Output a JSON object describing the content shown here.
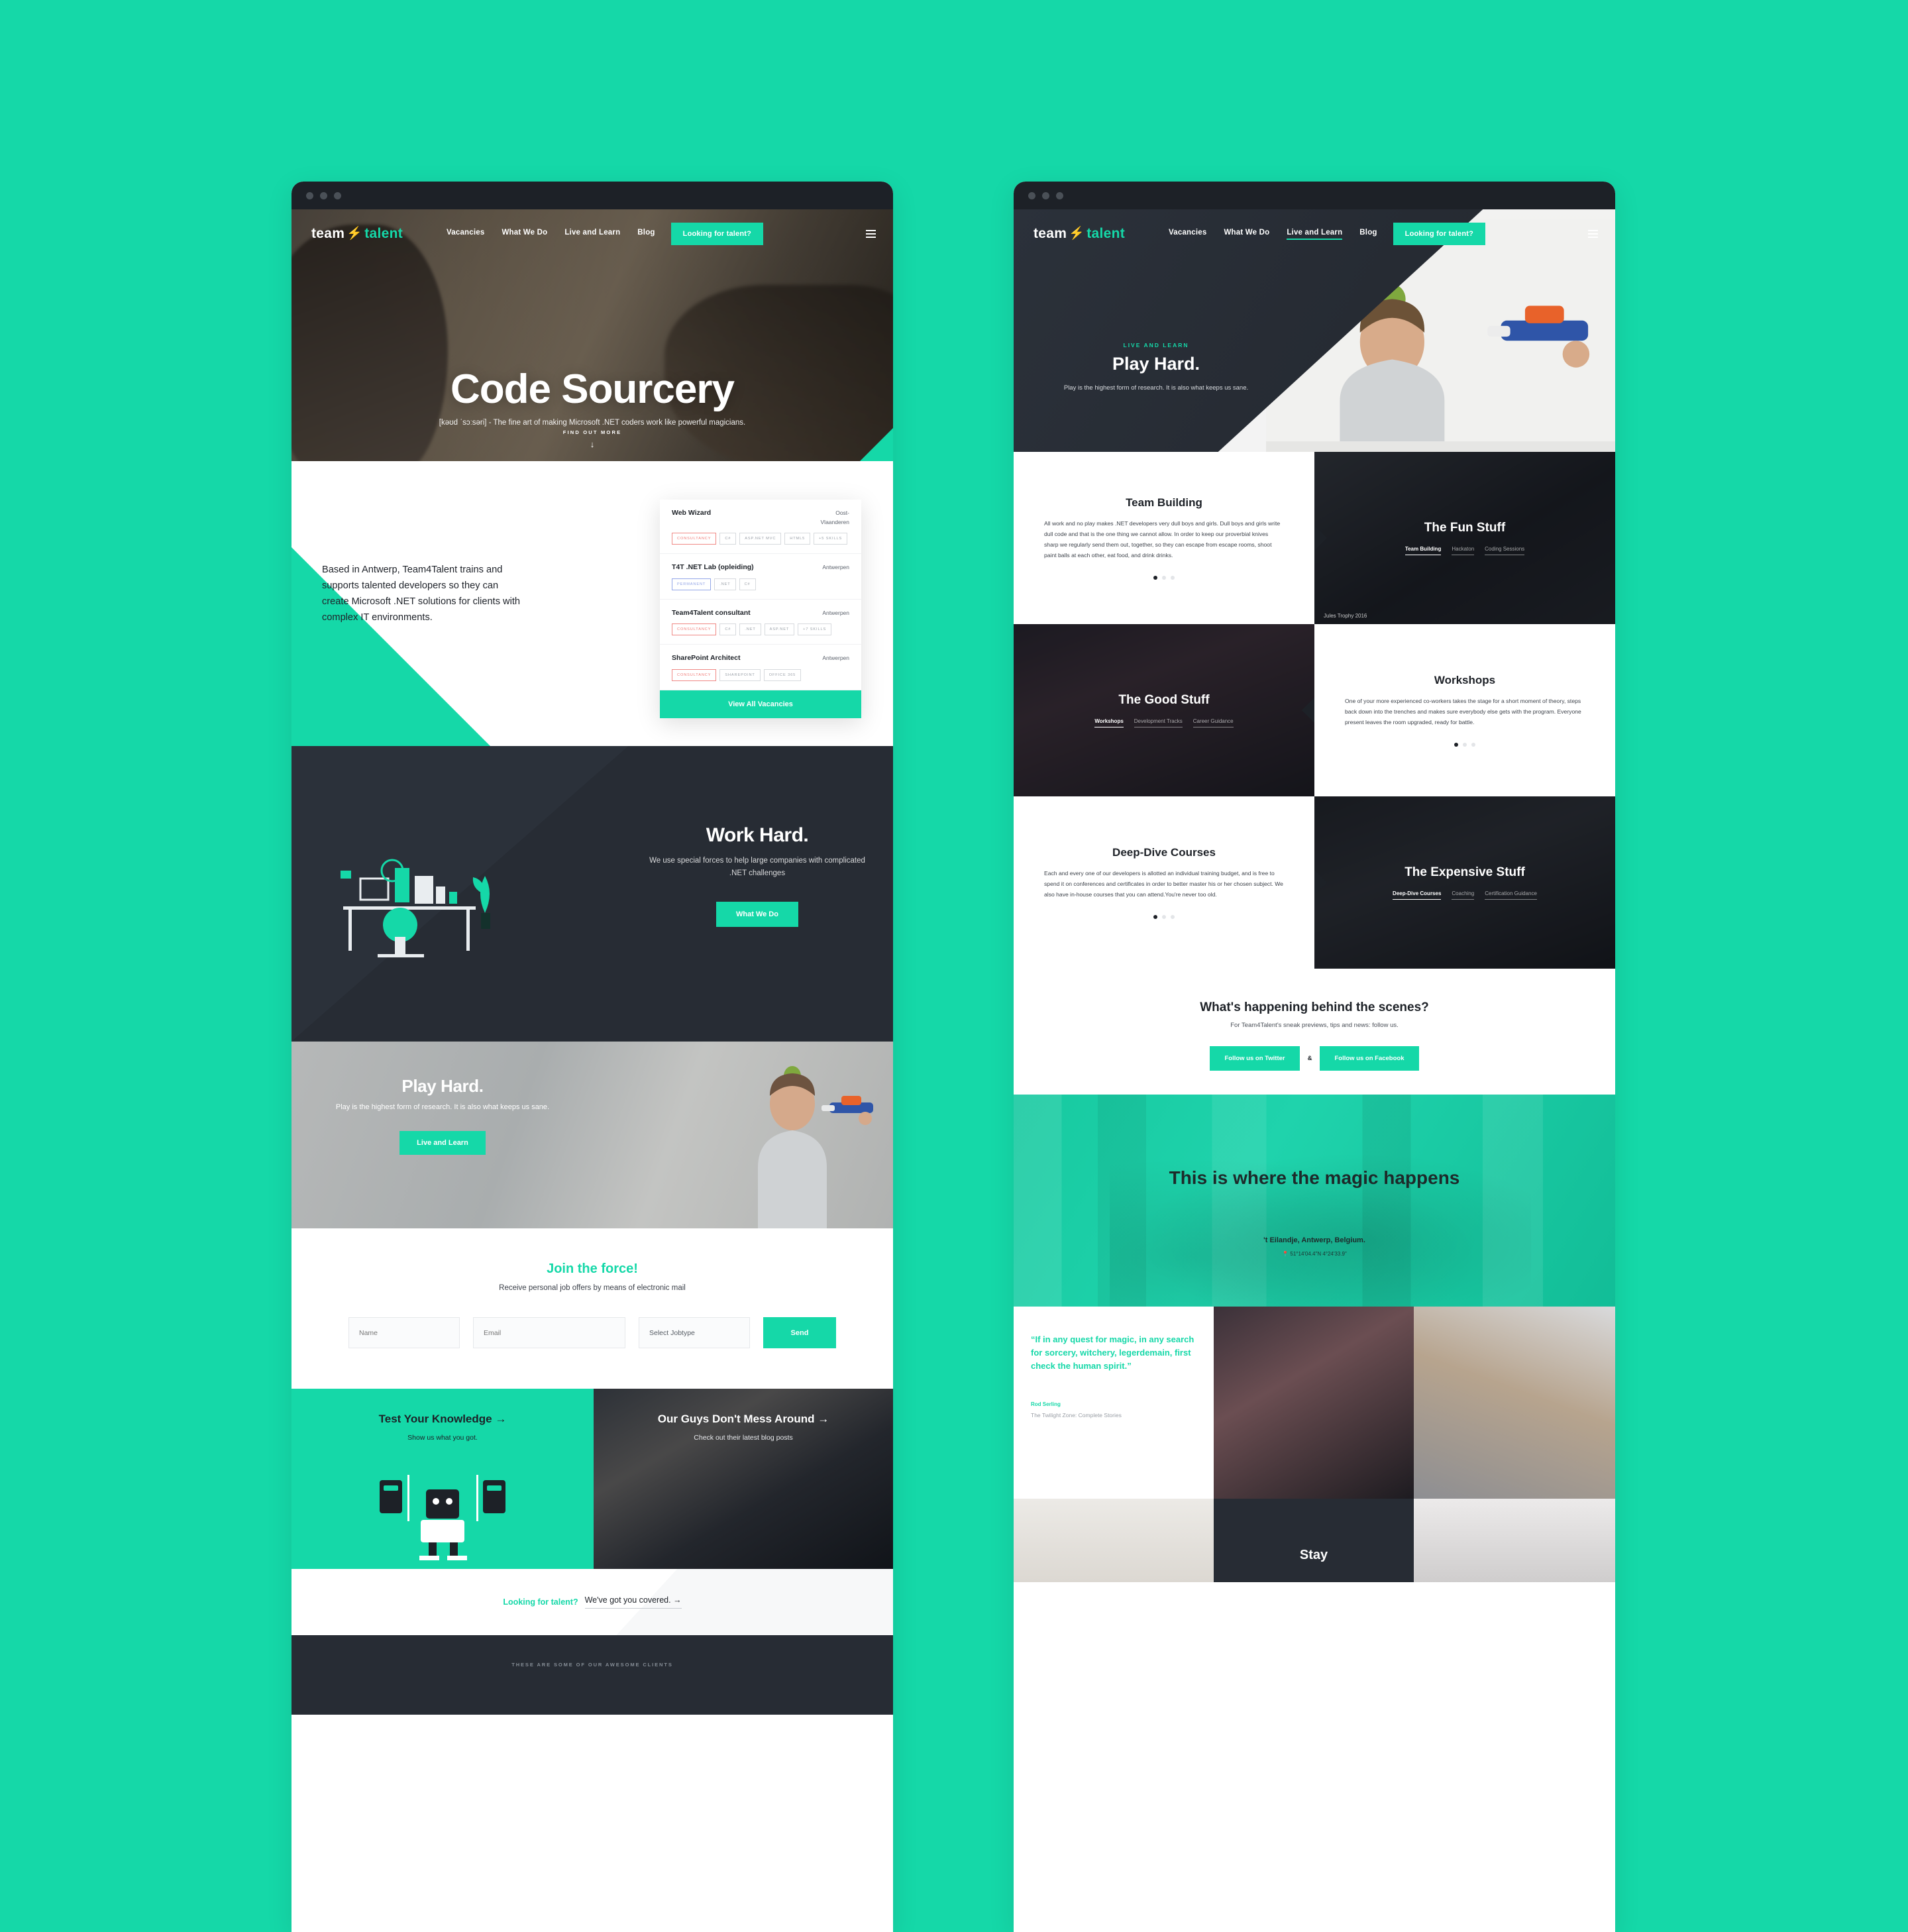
{
  "brand": {
    "name_1": "team",
    "bolt": "⚡",
    "name_2": "talent",
    "accent": "#15D8A8",
    "dark": "#272c34"
  },
  "nav": {
    "links": [
      {
        "label": "Vacancies",
        "active": false
      },
      {
        "label": "What We Do",
        "active": false
      },
      {
        "label": "Live and Learn",
        "active": false
      },
      {
        "label": "Blog",
        "active": false
      }
    ],
    "links_right": [
      {
        "label": "Vacancies",
        "active": false
      },
      {
        "label": "What We Do",
        "active": false
      },
      {
        "label": "Live and Learn",
        "active": true
      },
      {
        "label": "Blog",
        "active": false
      }
    ],
    "cta": "Looking for talent?"
  },
  "left": {
    "hero": {
      "title": "Code Sourcery",
      "subtitle": "[kəʊd ˈsɔːsəri] - The fine art of making Microsoft .NET coders work like powerful magicians.",
      "scroll_label": "FIND OUT MORE",
      "scroll_arrow": "↓"
    },
    "intro": {
      "text": "Based in Antwerp, Team4Talent trains and supports talented developers so they can create Microsoft .NET solutions for clients with complex IT environments."
    },
    "vacancies": {
      "items": [
        {
          "title": "Web Wizard",
          "location": "Oost-Vlaanderen",
          "tags": [
            {
              "label": "CONSULTANCY",
              "style": "red"
            },
            {
              "label": "C#",
              "style": "grey"
            },
            {
              "label": "ASP.NET MVC",
              "style": "grey"
            },
            {
              "label": "HTML5",
              "style": "grey"
            },
            {
              "label": "+5 SKILLS",
              "style": "grey"
            }
          ]
        },
        {
          "title": "T4T .NET Lab (opleiding)",
          "location": "Antwerpen",
          "tags": [
            {
              "label": "PERMANENT",
              "style": "blue"
            },
            {
              "label": ".NET",
              "style": "grey"
            },
            {
              "label": "C#",
              "style": "grey"
            }
          ]
        },
        {
          "title": "Team4Talent consultant",
          "location": "Antwerpen",
          "tags": [
            {
              "label": "CONSULTANCY",
              "style": "red"
            },
            {
              "label": "C#",
              "style": "grey"
            },
            {
              "label": ".NET",
              "style": "grey"
            },
            {
              "label": "ASP.NET",
              "style": "grey"
            },
            {
              "label": "+7 SKILLS",
              "style": "grey"
            }
          ]
        },
        {
          "title": "SharePoint Architect",
          "location": "Antwerpen",
          "tags": [
            {
              "label": "CONSULTANCY",
              "style": "red"
            },
            {
              "label": "SHAREPOINT",
              "style": "grey"
            },
            {
              "label": "OFFICE 365",
              "style": "grey"
            }
          ]
        }
      ],
      "view_all": "View All Vacancies"
    },
    "work": {
      "title": "Work Hard.",
      "text": "We use special forces to help large companies with complicated .NET challenges",
      "button": "What We Do"
    },
    "play": {
      "title": "Play Hard.",
      "text": "Play is the highest form of research. It is also what keeps us sane.",
      "button": "Live and Learn"
    },
    "join": {
      "title": "Join the force!",
      "subtitle": "Receive personal job offers by means of electronic mail",
      "name_placeholder": "Name",
      "email_placeholder": "Email",
      "jobtype_value": "Select Jobtype",
      "send_label": "Send"
    },
    "promos": [
      {
        "title": "Test Your Knowledge",
        "arrow": "→",
        "subtitle": "Show us what you got."
      },
      {
        "title": "Our Guys Don't Mess Around",
        "arrow": "→",
        "subtitle": "Check out their latest blog posts"
      }
    ],
    "talent_strip": {
      "accent_text": "Looking for talent?",
      "link_text": "We've got you covered.",
      "arrow": "→"
    },
    "clients": {
      "title": "THESE ARE SOME OF OUR AWESOME CLIENTS"
    }
  },
  "right": {
    "hero": {
      "eyebrow": "LIVE AND LEARN",
      "title": "Play Hard.",
      "text": "Play is the highest form of research. It is also what keeps us sane."
    },
    "rows": [
      {
        "text_side": "left",
        "title": "Team Building",
        "body": "All work and no play makes .NET developers very dull boys and girls. Dull boys and girls write dull code and that is the one thing we cannot allow. In order to keep our proverbial knives sharp we regularly send them out, together, so they can escape from escape rooms, shoot paint balls at each other, eat food, and drink drinks.",
        "dots": 3,
        "active_dot": 0,
        "image_title": "The Fun Stuff",
        "tabs": [
          "Team Building",
          "Hackaton",
          "Coding Sessions"
        ],
        "active_tab": 0,
        "caption": "Jules Trophy 2016"
      },
      {
        "text_side": "right",
        "title": "Workshops",
        "body": "One of your more experienced co-workers takes the stage for a short moment of theory, steps back down into the trenches and makes sure everybody else gets with the program. Everyone present leaves the room upgraded, ready for battle.",
        "dots": 3,
        "active_dot": 0,
        "image_title": "The Good Stuff",
        "tabs": [
          "Workshops",
          "Development Tracks",
          "Career Guidance"
        ],
        "active_tab": 0,
        "caption": ""
      },
      {
        "text_side": "left",
        "title": "Deep-Dive Courses",
        "body": "Each and every one of our developers is allotted an individual training budget, and is free to spend it on conferences and certificates in order to better master his or her chosen subject. We also have in-house courses that you can attend.You're never too old.",
        "dots": 3,
        "active_dot": 0,
        "image_title": "The Expensive Stuff",
        "tabs": [
          "Deep-Dive Courses",
          "Coaching",
          "Certification Guidance"
        ],
        "active_tab": 0,
        "caption": ""
      }
    ],
    "behind": {
      "title": "What's happening behind the scenes?",
      "subtitle": "For Team4Talent's sneak previews, tips and news: follow us.",
      "twitter": "Follow us on Twitter",
      "amp": "&",
      "facebook": "Follow us on Facebook"
    },
    "magic": {
      "title": "This is where the magic happens",
      "location": "'t Eilandje, Antwerp, Belgium.",
      "pin_icon": "📍",
      "coordinates": "51°14'04.4\"N 4°24'33.9\""
    },
    "quote": {
      "text": "“If in any quest for magic, in any search for sorcery, witchery, legerdemain, first check the human spirit.”",
      "author": "Rod Serling",
      "source": "The Twilight Zone: Complete Stories"
    },
    "bottom": {
      "stay": "Stay"
    }
  }
}
